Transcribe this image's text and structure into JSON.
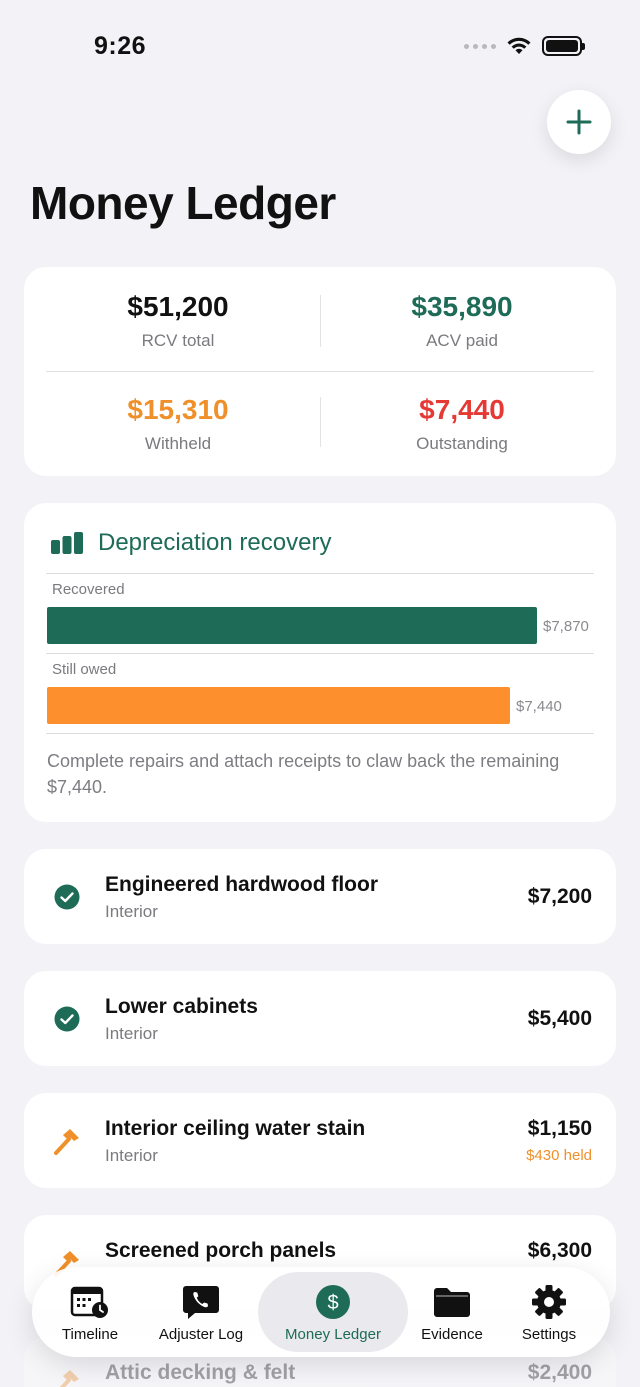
{
  "status_bar": {
    "time": "9:26"
  },
  "page": {
    "title": "Money Ledger"
  },
  "colors": {
    "green": "#1e6b57",
    "orange": "#f0902a",
    "red": "#e53935",
    "background": "#f2f2f7"
  },
  "summary": {
    "rcv": {
      "amount": "$51,200",
      "label": "RCV total"
    },
    "acv": {
      "amount": "$35,890",
      "label": "ACV paid"
    },
    "withheld": {
      "amount": "$15,310",
      "label": "Withheld"
    },
    "outstanding": {
      "amount": "$7,440",
      "label": "Outstanding"
    }
  },
  "depreciation": {
    "title": "Depreciation recovery",
    "recovered": {
      "label": "Recovered",
      "value": "$7,870",
      "amount": 7870
    },
    "still_owed": {
      "label": "Still owed",
      "value": "$7,440",
      "amount": 7440
    },
    "note": "Complete repairs and attach receipts to claw back the remaining $7,440."
  },
  "items": [
    {
      "name": "Engineered hardwood floor",
      "category": "Interior",
      "amount": "$7,200",
      "status": "complete",
      "icon": "check-circle-icon"
    },
    {
      "name": "Lower cabinets",
      "category": "Interior",
      "amount": "$5,400",
      "status": "complete",
      "icon": "check-circle-icon"
    },
    {
      "name": "Interior ceiling water stain",
      "category": "Interior",
      "amount": "$1,150",
      "held": "$430 held",
      "status": "in-progress",
      "icon": "hammer-icon"
    },
    {
      "name": "Screened porch panels",
      "category": "",
      "amount": "$6,300",
      "status": "in-progress",
      "icon": "hammer-icon"
    },
    {
      "name": "Attic decking & felt",
      "category": "",
      "amount": "$2,400",
      "status": "in-progress",
      "icon": "hammer-icon"
    }
  ],
  "tabs": [
    {
      "label": "Timeline",
      "icon": "calendar-clock-icon",
      "active": false
    },
    {
      "label": "Adjuster Log",
      "icon": "phone-bubble-icon",
      "active": false
    },
    {
      "label": "Money Ledger",
      "icon": "dollar-circle-icon",
      "active": true
    },
    {
      "label": "Evidence",
      "icon": "folder-icon",
      "active": false
    },
    {
      "label": "Settings",
      "icon": "gear-icon",
      "active": false
    }
  ]
}
